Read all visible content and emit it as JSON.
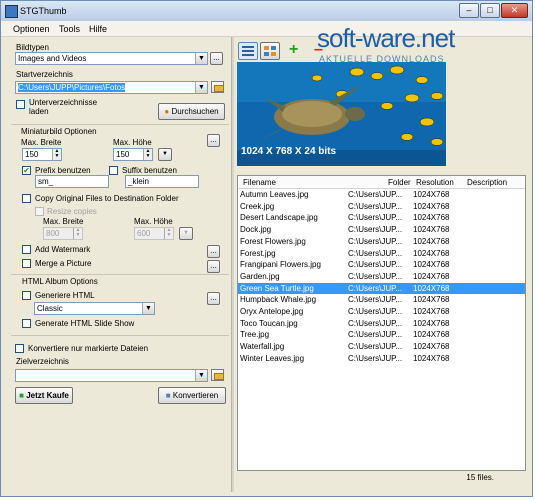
{
  "window": {
    "title": "STGThumb"
  },
  "menu": {
    "optionen": "Optionen",
    "tools": "Tools",
    "hilfe": "Hilfe"
  },
  "left": {
    "bildtypen_label": "Bildtypen",
    "bildtypen_value": "Images and Videos",
    "startverzeichnis_label": "Startverzeichnis",
    "startverzeichnis_value": "C:\\Users\\JUPP\\Pictures\\Fotos",
    "unterverzeichnisse_label": "Unterverzeichnisse",
    "unterverzeichnisse_label2": "laden",
    "durchsuchen": "Durchsuchen",
    "miniaturbild_header": "Miniaturbild Optionen",
    "max_breite_label": "Max. Breite",
    "max_hoehe_label": "Max. Höhe",
    "max_breite_value": "150",
    "max_hoehe_value": "150",
    "prefix_label": "Prefix benutzen",
    "prefix_value": "sm_",
    "suffix_label": "Suffix benutzen",
    "suffix_value": "_klein",
    "copy_original_label": "Copy Original Files to Destination Folder",
    "resize_copies_label": "Resize copies",
    "copy_max_breite_label": "Max. Breite",
    "copy_max_hoehe_label": "Max. Höhe",
    "copy_max_breite_value": "800",
    "copy_max_hoehe_value": "600",
    "add_watermark_label": "Add Watermark",
    "merge_picture_label": "Merge a Picture",
    "html_header": "HTML Album Options",
    "generiere_html_label": "Generiere HTML",
    "html_style_value": "Classic",
    "slide_show_label": "Generate HTML Slide Show",
    "konvertiere_label": "Konvertiere nur markierte Dateien",
    "zielverzeichnis_label": "Zielverzeichnis",
    "zielverzeichnis_value": "",
    "jetzt_kaufen": "Jetzt Kaufe",
    "konvertieren": "Konvertieren"
  },
  "preview": {
    "caption": "1024 X 768 X 24 bits"
  },
  "watermark": {
    "brand": "soft-ware.net",
    "sub": "AKTUELLE DOWNLOADS"
  },
  "list": {
    "columns": [
      "Filename",
      "Folder",
      "Resolution",
      "Description"
    ],
    "rows": [
      {
        "name": "Autumn Leaves.jpg",
        "folder": "C:\\Users\\JUP...",
        "res": "1024X768"
      },
      {
        "name": "Creek.jpg",
        "folder": "C:\\Users\\JUP...",
        "res": "1024X768"
      },
      {
        "name": "Desert Landscape.jpg",
        "folder": "C:\\Users\\JUP...",
        "res": "1024X768"
      },
      {
        "name": "Dock.jpg",
        "folder": "C:\\Users\\JUP...",
        "res": "1024X768"
      },
      {
        "name": "Forest Flowers.jpg",
        "folder": "C:\\Users\\JUP...",
        "res": "1024X768"
      },
      {
        "name": "Forest.jpg",
        "folder": "C:\\Users\\JUP...",
        "res": "1024X768"
      },
      {
        "name": "Frangipani Flowers.jpg",
        "folder": "C:\\Users\\JUP...",
        "res": "1024X768"
      },
      {
        "name": "Garden.jpg",
        "folder": "C:\\Users\\JUP...",
        "res": "1024X768"
      },
      {
        "name": "Green Sea Turtle.jpg",
        "folder": "C:\\Users\\JUP...",
        "res": "1024X768"
      },
      {
        "name": "Humpback Whale.jpg",
        "folder": "C:\\Users\\JUP...",
        "res": "1024X768"
      },
      {
        "name": "Oryx Antelope.jpg",
        "folder": "C:\\Users\\JUP...",
        "res": "1024X768"
      },
      {
        "name": "Toco Toucan.jpg",
        "folder": "C:\\Users\\JUP...",
        "res": "1024X768"
      },
      {
        "name": "Tree.jpg",
        "folder": "C:\\Users\\JUP...",
        "res": "1024X768"
      },
      {
        "name": "Waterfall.jpg",
        "folder": "C:\\Users\\JUP...",
        "res": "1024X768"
      },
      {
        "name": "Winter Leaves.jpg",
        "folder": "C:\\Users\\JUP...",
        "res": "1024X768"
      }
    ],
    "selected_row": "Green Sea Turtle.jpg",
    "status": "15 files."
  },
  "colors": {
    "selection": "#3399ff",
    "window_bg": "#ece9d8",
    "preview_water": "#0f6db6"
  }
}
